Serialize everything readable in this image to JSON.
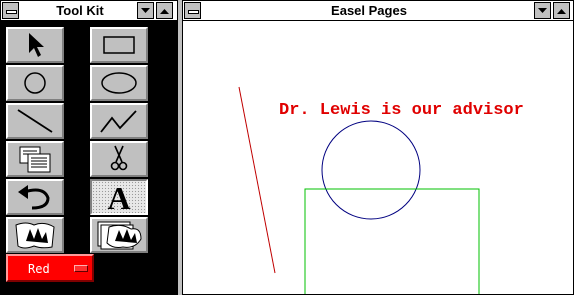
{
  "toolkit": {
    "title": "Tool Kit",
    "tools": [
      {
        "icon": "arrow-select-icon"
      },
      {
        "icon": "rectangle-icon"
      },
      {
        "icon": "circle-icon"
      },
      {
        "icon": "ellipse-icon"
      },
      {
        "icon": "line-icon"
      },
      {
        "icon": "polyline-icon"
      },
      {
        "icon": "copy-pages-icon"
      },
      {
        "icon": "scissors-icon"
      },
      {
        "icon": "undo-arrow-icon"
      },
      {
        "icon": "text-tool-icon",
        "glyph": "A",
        "selected": true
      },
      {
        "icon": "eraser-hand-icon"
      },
      {
        "icon": "clear-pages-hand-icon"
      }
    ],
    "color_picker": {
      "label": "Red",
      "color": "#ff0000"
    }
  },
  "easel": {
    "title": "Easel Pages",
    "text_label": "Dr. Lewis is our advisor",
    "text_color": "#e00000",
    "circle_color": "#000080",
    "rect_color": "#00c000",
    "line_color": "#c00000"
  }
}
